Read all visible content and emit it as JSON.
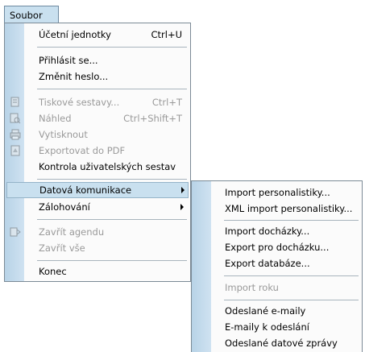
{
  "menubar": {
    "label": "Soubor"
  },
  "main_menu": {
    "items": [
      {
        "label": "Účetní jednotky",
        "shortcut": "Ctrl+U"
      },
      {
        "label": "Přihlásit se..."
      },
      {
        "label": "Změnit heslo..."
      },
      {
        "label": "Tiskové sestavy...",
        "shortcut": "Ctrl+T"
      },
      {
        "label": "Náhled",
        "shortcut": "Ctrl+Shift+T"
      },
      {
        "label": "Vytisknout"
      },
      {
        "label": "Exportovat do PDF"
      },
      {
        "label": "Kontrola uživatelských sestav"
      },
      {
        "label": "Datová komunikace"
      },
      {
        "label": "Zálohování"
      },
      {
        "label": "Zavřít agendu"
      },
      {
        "label": "Zavřít vše"
      },
      {
        "label": "Konec"
      }
    ]
  },
  "submenu": {
    "items": [
      {
        "label": "Import personalistiky..."
      },
      {
        "label": "XML import personalistiky..."
      },
      {
        "label": "Import docházky..."
      },
      {
        "label": "Export pro docházku..."
      },
      {
        "label": "Export databáze..."
      },
      {
        "label": "Import roku"
      },
      {
        "label": "Odeslané e-maily"
      },
      {
        "label": "E-maily k odeslání"
      },
      {
        "label": "Odeslané datové zprávy"
      }
    ]
  }
}
